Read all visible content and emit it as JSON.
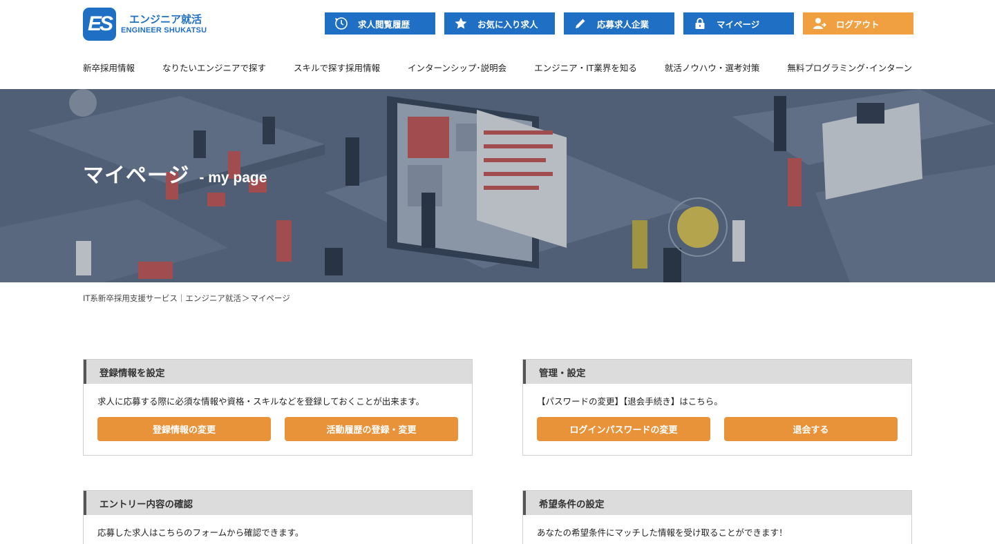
{
  "header": {
    "logo": {
      "mark": "ES",
      "jp": "エンジニア就活",
      "en": "ENGINEER SHUKATSU"
    },
    "top_buttons": [
      {
        "label": "求人閲覧履歴",
        "icon": "clock-icon"
      },
      {
        "label": "お気に入り求人",
        "icon": "star-icon"
      },
      {
        "label": "応募求人企業",
        "icon": "pencil-icon"
      },
      {
        "label": "マイページ",
        "icon": "lock-icon"
      },
      {
        "label": "ログアウト",
        "icon": "user-icon"
      }
    ],
    "nav": [
      "新卒採用情報",
      "なりたいエンジニアで探す",
      "スキルで探す採用情報",
      "インターンシップ･説明会",
      "エンジニア・IT業界を知る",
      "就活ノウハウ・選考対策",
      "無料プログラミング･インターン"
    ],
    "colors": {
      "primary": "#1f6fc5",
      "logout": "#f0a040"
    }
  },
  "hero": {
    "title_jp": "マイページ",
    "title_en": "- my page"
  },
  "breadcrumb": {
    "home": "IT系新卒採用支援サービス｜エンジニア就活",
    "separator": "＞",
    "current": "マイページ"
  },
  "panels": [
    {
      "title": "登録情報を設定",
      "description": "求人に応募する際に必須な情報や資格・スキルなどを登録しておくことが出来ます。",
      "buttons": [
        "登録情報の変更",
        "活動履歴の登録・変更"
      ]
    },
    {
      "title": "管理・設定",
      "description": "【パスワードの変更】【退会手続き】はこちら。",
      "buttons": [
        "ログインパスワードの変更",
        "退会する"
      ]
    },
    {
      "title": "エントリー内容の確認",
      "description": "応募した求人はこちらのフォームから確認できます。",
      "buttons": []
    },
    {
      "title": "希望条件の設定",
      "description": "あなたの希望条件にマッチした情報を受け取ることができます！",
      "buttons": []
    }
  ],
  "button_color": "#e8923a"
}
